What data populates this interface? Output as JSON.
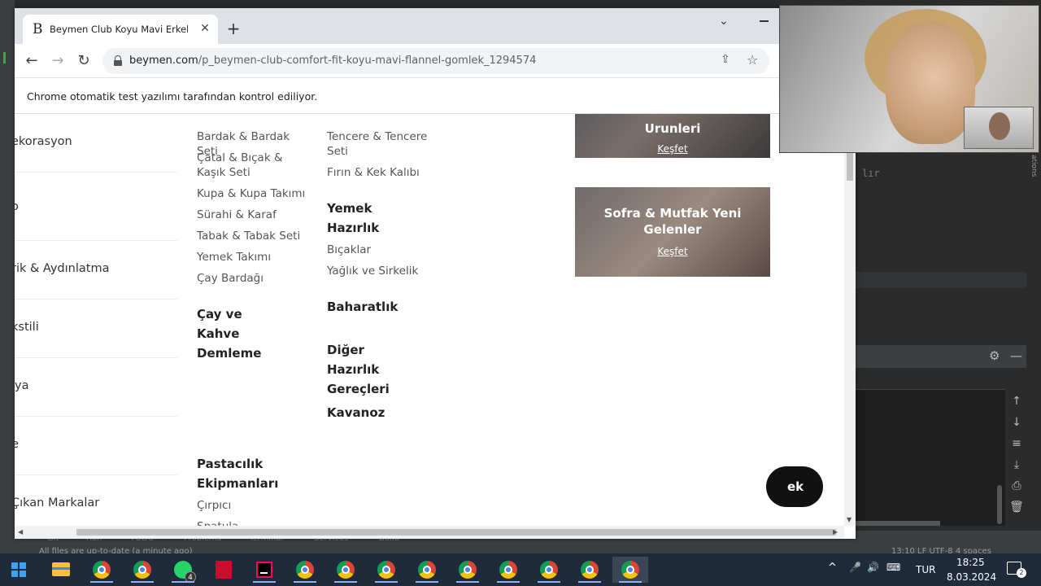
{
  "browser": {
    "tab_title": "Beymen Club Koyu Mavi Erkek C",
    "tab_favicon": "B",
    "url_domain": "beymen.com",
    "url_path": "/p_beymen-club-comfort-fit-koyu-mavi-flannel-gomlek_1294574",
    "automation_notice": "Chrome otomatik test yazılımı tarafından kontrol ediliyor."
  },
  "sidebar": {
    "items": [
      {
        "label": "ekorasyon"
      },
      {
        "label": "o"
      },
      {
        "label": "rik & Aydınlatma"
      },
      {
        "label": "kstili"
      },
      {
        "label": "iya"
      },
      {
        "label": "e"
      },
      {
        "label": "Çıkan Markalar"
      }
    ]
  },
  "menu": {
    "col1_links": [
      "Bardak & Bardak Seti",
      "Çatal & Bıçak & Kaşık Seti",
      "Kupa & Kupa Takımı",
      "Sürahi & Karaf",
      "Tabak & Tabak Seti",
      "Yemek Takımı",
      "Çay Bardağı"
    ],
    "col1_heading_tea": "Çay ve Kahve Demleme",
    "col1_heading_pastry": "Pastacılık Ekipmanları",
    "col1_pastry_links": [
      "Çırpıcı",
      "Spatula"
    ],
    "col2_links_top": [
      "Tencere & Tencere Seti",
      "Fırın & Kek Kalıbı"
    ],
    "col2_heading_prep": "Yemek Hazırlık",
    "col2_prep_links": [
      "Bıçaklar",
      "Yağlık ve Sirkelik"
    ],
    "col2_heading_spice": "Baharatlık",
    "col2_heading_other": "Diğer Hazırlık Gereçleri",
    "col2_heading_jar": "Kavanoz"
  },
  "promos": [
    {
      "title": "Urunleri",
      "cta": "Keşfet"
    },
    {
      "title": "Sofra & Mutfak Yeni Gelenler",
      "cta": "Keşfet"
    }
  ],
  "chat_button": {
    "label": "ek"
  },
  "ide": {
    "code_snippet": "lır",
    "side_label": "ations",
    "bottom_tabs": [
      "Git",
      "Run",
      "TODO",
      "Problems",
      "Terminal",
      "Services",
      "Build"
    ],
    "status_left": "All files are up-to-date (a minute ago)",
    "status_right": "13:10  LF  UTF-8  4 spaces"
  },
  "taskbar": {
    "whatsapp_badge": "4",
    "lang": "TUR",
    "time": "18:25",
    "date": "8.03.2024",
    "notif_count": "2"
  }
}
